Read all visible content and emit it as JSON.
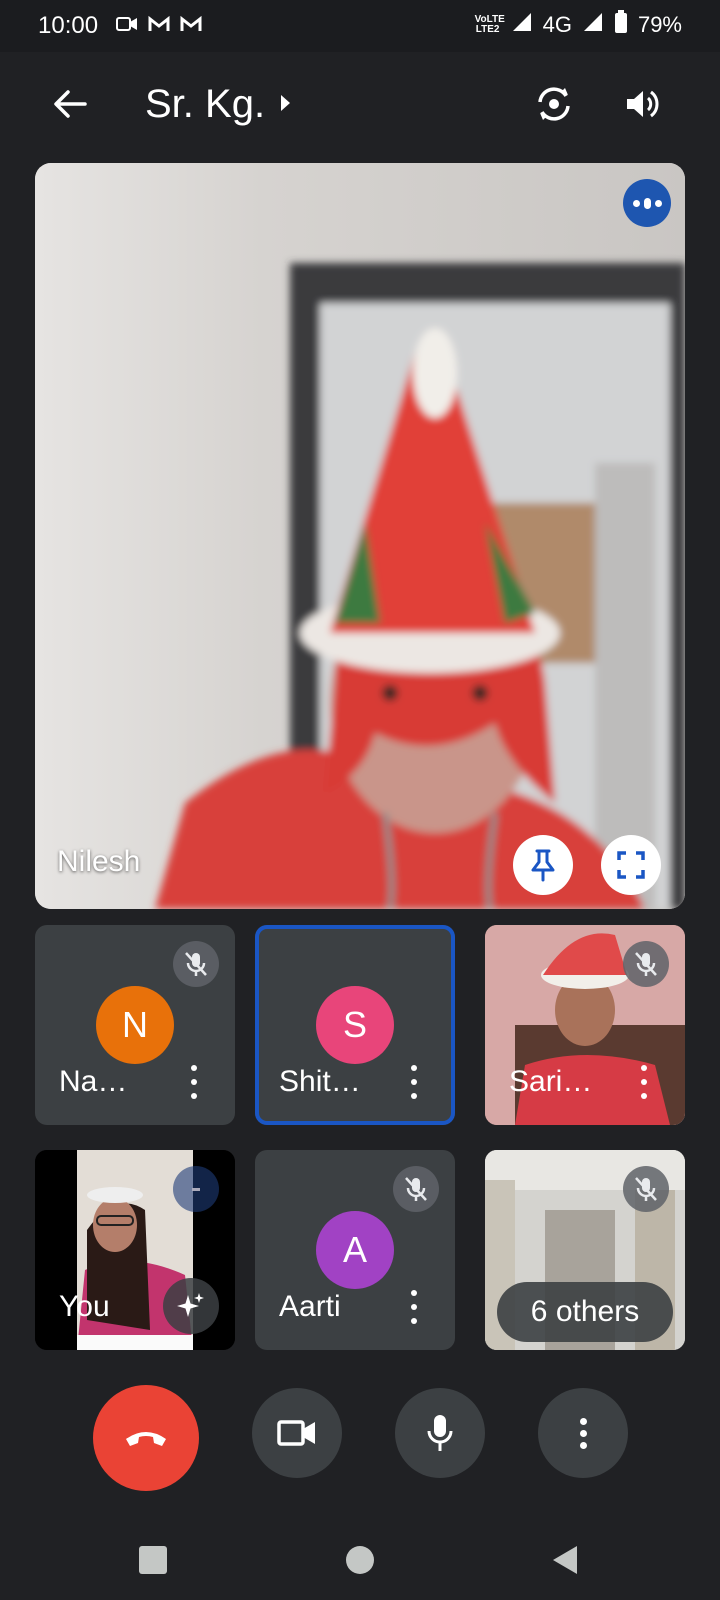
{
  "status_bar": {
    "time": "10:00",
    "left_icons": [
      "video-recorder-icon",
      "gmail-icon",
      "gmail-icon"
    ],
    "volte": "VoLTE LTE2",
    "network": "4G",
    "battery": "79%"
  },
  "header": {
    "title": "Sr. Kg.",
    "back_icon": "arrow-back-icon",
    "title_caret_icon": "caret-right-icon",
    "switch_camera_icon": "switch-camera-icon",
    "audio_icon": "speaker-icon"
  },
  "main_tile": {
    "name": "Nilesh",
    "speaking_badge_icon": "speaking-dots-icon",
    "pin_icon": "pin-icon",
    "fullscreen_icon": "fullscreen-icon"
  },
  "participants": [
    {
      "name": "Na…",
      "initial": "N",
      "color": "#e8710a",
      "muted": true,
      "video": false
    },
    {
      "name": "Shit…",
      "initial": "S",
      "color": "#e8457a",
      "muted": false,
      "video": false,
      "selected": true
    },
    {
      "name": "Sari…",
      "muted": true,
      "video": true
    },
    {
      "name": "You",
      "video": true,
      "effects_icon": "sparkle-icon"
    },
    {
      "name": "Aarti",
      "initial": "A",
      "color": "#a142c4",
      "muted": true,
      "video": false
    },
    {
      "label": "6 others",
      "muted": true,
      "video": true
    }
  ],
  "controls": {
    "end_call_icon": "call-end-icon",
    "camera_icon": "videocam-icon",
    "mic_icon": "mic-icon",
    "more_icon": "more-vert-icon"
  },
  "colors": {
    "end_call": "#ea4335",
    "selected_border": "#1a56c4",
    "tile_bg": "#3c4043",
    "badge_blue": "#1e56b0"
  }
}
